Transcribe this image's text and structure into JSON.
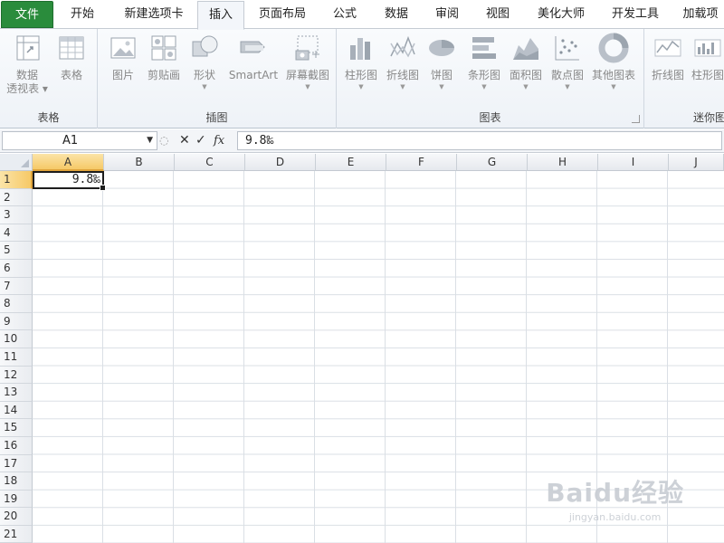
{
  "ribbon": {
    "tabs": [
      {
        "label": "文件",
        "key": "file"
      },
      {
        "label": "开始",
        "key": "home"
      },
      {
        "label": "新建选项卡",
        "key": "newtab"
      },
      {
        "label": "插入",
        "key": "insert"
      },
      {
        "label": "页面布局",
        "key": "layout"
      },
      {
        "label": "公式",
        "key": "formulas"
      },
      {
        "label": "数据",
        "key": "data"
      },
      {
        "label": "审阅",
        "key": "review"
      },
      {
        "label": "视图",
        "key": "view"
      },
      {
        "label": "美化大师",
        "key": "beautify"
      },
      {
        "label": "开发工具",
        "key": "developer"
      },
      {
        "label": "加载项",
        "key": "addins"
      }
    ],
    "active_tab": "插入",
    "groups": {
      "tables": {
        "label": "表格",
        "pivot_line1": "数据",
        "pivot_line2": "透视表",
        "table": "表格"
      },
      "illustrations": {
        "label": "插图",
        "picture": "图片",
        "clipart": "剪贴画",
        "shapes": "形状",
        "smartart": "SmartArt",
        "screenshot": "屏幕截图"
      },
      "charts": {
        "label": "图表",
        "column": "柱形图",
        "line": "折线图",
        "pie": "饼图",
        "bar": "条形图",
        "area": "面积图",
        "scatter": "散点图",
        "other": "其他图表"
      },
      "sparklines": {
        "label": "迷你图",
        "line": "折线图",
        "column": "柱形图"
      }
    },
    "accent_color": "#2a8c3c"
  },
  "formula_bar": {
    "name_box": "A1",
    "cancel_symbol": "✕",
    "enter_symbol": "✓",
    "fx_symbol": "fx",
    "value": "9.8‰"
  },
  "sheet": {
    "columns": [
      "A",
      "B",
      "C",
      "D",
      "E",
      "F",
      "G",
      "H",
      "I",
      "J"
    ],
    "rows": [
      "1",
      "2",
      "3",
      "4",
      "5",
      "6",
      "7",
      "8",
      "9",
      "10",
      "11",
      "12",
      "13",
      "14",
      "15",
      "16",
      "17",
      "18",
      "19",
      "20",
      "21"
    ],
    "selected_cell": "A1",
    "cells": {
      "A1": "9.8‰"
    }
  },
  "watermark": {
    "brand": "Baidu经验",
    "url": "jingyan.baidu.com"
  }
}
